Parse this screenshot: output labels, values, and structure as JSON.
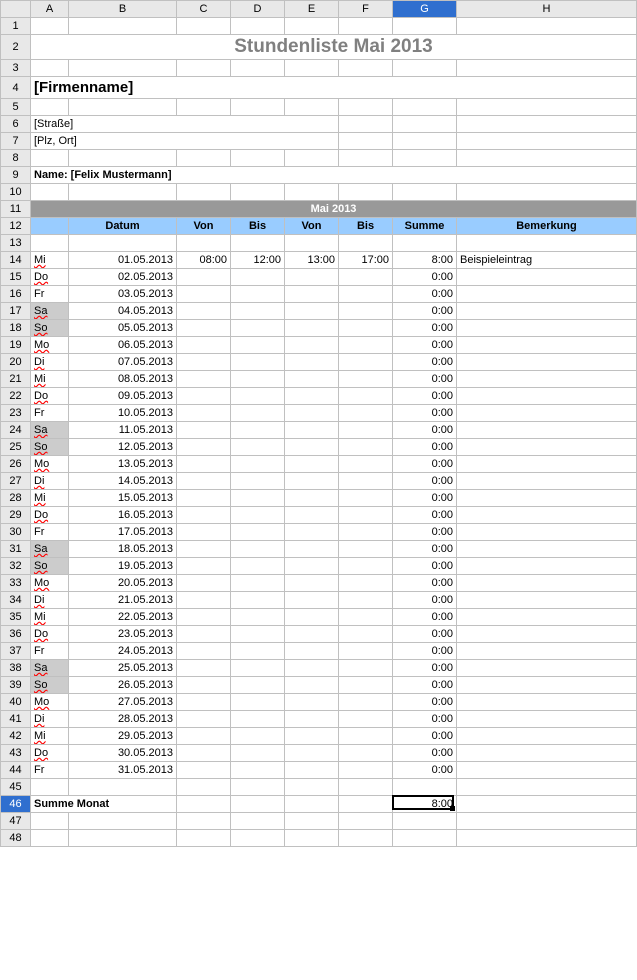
{
  "columns": [
    {
      "label": "A",
      "w": 38
    },
    {
      "label": "B",
      "w": 108
    },
    {
      "label": "C",
      "w": 54
    },
    {
      "label": "D",
      "w": 54
    },
    {
      "label": "E",
      "w": 54
    },
    {
      "label": "F",
      "w": 54
    },
    {
      "label": "G",
      "w": 64
    },
    {
      "label": "H",
      "w": 180
    }
  ],
  "activeCol": "G",
  "activeRow": 46,
  "title": "Stundenliste Mai 2013",
  "firm": "[Firmenname]",
  "street": "[Straße]",
  "city": "[Plz, Ort]",
  "nameLabel": "Name: [Felix Mustermann]",
  "monthHeader": "Mai 2013",
  "headers": {
    "datum": "Datum",
    "von": "Von",
    "bis": "Bis",
    "von2": "Von",
    "bis2": "Bis",
    "summe": "Summe",
    "bemerkung": "Bemerkung"
  },
  "rows": [
    {
      "r": 14,
      "wd": "Mi",
      "sp": true,
      "date": "01.05.2013",
      "v1": "08:00",
      "b1": "12:00",
      "v2": "13:00",
      "b2": "17:00",
      "sum": "8:00",
      "note": "Beispieleintrag"
    },
    {
      "r": 15,
      "wd": "Do",
      "sp": true,
      "date": "02.05.2013",
      "sum": "0:00"
    },
    {
      "r": 16,
      "wd": "Fr",
      "date": "03.05.2013",
      "sum": "0:00"
    },
    {
      "r": 17,
      "wd": "Sa",
      "sp": true,
      "we": true,
      "date": "04.05.2013",
      "sum": "0:00"
    },
    {
      "r": 18,
      "wd": "So",
      "sp": true,
      "we": true,
      "date": "05.05.2013",
      "sum": "0:00"
    },
    {
      "r": 19,
      "wd": "Mo",
      "sp": true,
      "date": "06.05.2013",
      "sum": "0:00"
    },
    {
      "r": 20,
      "wd": "Di",
      "sp": true,
      "date": "07.05.2013",
      "sum": "0:00"
    },
    {
      "r": 21,
      "wd": "Mi",
      "sp": true,
      "date": "08.05.2013",
      "sum": "0:00"
    },
    {
      "r": 22,
      "wd": "Do",
      "sp": true,
      "date": "09.05.2013",
      "sum": "0:00"
    },
    {
      "r": 23,
      "wd": "Fr",
      "date": "10.05.2013",
      "sum": "0:00"
    },
    {
      "r": 24,
      "wd": "Sa",
      "sp": true,
      "we": true,
      "date": "11.05.2013",
      "sum": "0:00"
    },
    {
      "r": 25,
      "wd": "So",
      "sp": true,
      "we": true,
      "date": "12.05.2013",
      "sum": "0:00"
    },
    {
      "r": 26,
      "wd": "Mo",
      "sp": true,
      "date": "13.05.2013",
      "sum": "0:00"
    },
    {
      "r": 27,
      "wd": "Di",
      "sp": true,
      "date": "14.05.2013",
      "sum": "0:00"
    },
    {
      "r": 28,
      "wd": "Mi",
      "sp": true,
      "date": "15.05.2013",
      "sum": "0:00"
    },
    {
      "r": 29,
      "wd": "Do",
      "sp": true,
      "date": "16.05.2013",
      "sum": "0:00"
    },
    {
      "r": 30,
      "wd": "Fr",
      "date": "17.05.2013",
      "sum": "0:00"
    },
    {
      "r": 31,
      "wd": "Sa",
      "sp": true,
      "we": true,
      "date": "18.05.2013",
      "sum": "0:00"
    },
    {
      "r": 32,
      "wd": "So",
      "sp": true,
      "we": true,
      "date": "19.05.2013",
      "sum": "0:00"
    },
    {
      "r": 33,
      "wd": "Mo",
      "sp": true,
      "date": "20.05.2013",
      "sum": "0:00"
    },
    {
      "r": 34,
      "wd": "Di",
      "sp": true,
      "date": "21.05.2013",
      "sum": "0:00"
    },
    {
      "r": 35,
      "wd": "Mi",
      "sp": true,
      "date": "22.05.2013",
      "sum": "0:00"
    },
    {
      "r": 36,
      "wd": "Do",
      "sp": true,
      "date": "23.05.2013",
      "sum": "0:00"
    },
    {
      "r": 37,
      "wd": "Fr",
      "date": "24.05.2013",
      "sum": "0:00"
    },
    {
      "r": 38,
      "wd": "Sa",
      "sp": true,
      "we": true,
      "date": "25.05.2013",
      "sum": "0:00"
    },
    {
      "r": 39,
      "wd": "So",
      "sp": true,
      "we": true,
      "date": "26.05.2013",
      "sum": "0:00"
    },
    {
      "r": 40,
      "wd": "Mo",
      "sp": true,
      "date": "27.05.2013",
      "sum": "0:00"
    },
    {
      "r": 41,
      "wd": "Di",
      "sp": true,
      "date": "28.05.2013",
      "sum": "0:00"
    },
    {
      "r": 42,
      "wd": "Mi",
      "sp": true,
      "date": "29.05.2013",
      "sum": "0:00"
    },
    {
      "r": 43,
      "wd": "Do",
      "sp": true,
      "date": "30.05.2013",
      "sum": "0:00"
    },
    {
      "r": 44,
      "wd": "Fr",
      "date": "31.05.2013",
      "sum": "0:00"
    }
  ],
  "sumLabel": "Summe Monat",
  "sumTotal": "8:00",
  "blankRows": [
    47,
    48
  ]
}
